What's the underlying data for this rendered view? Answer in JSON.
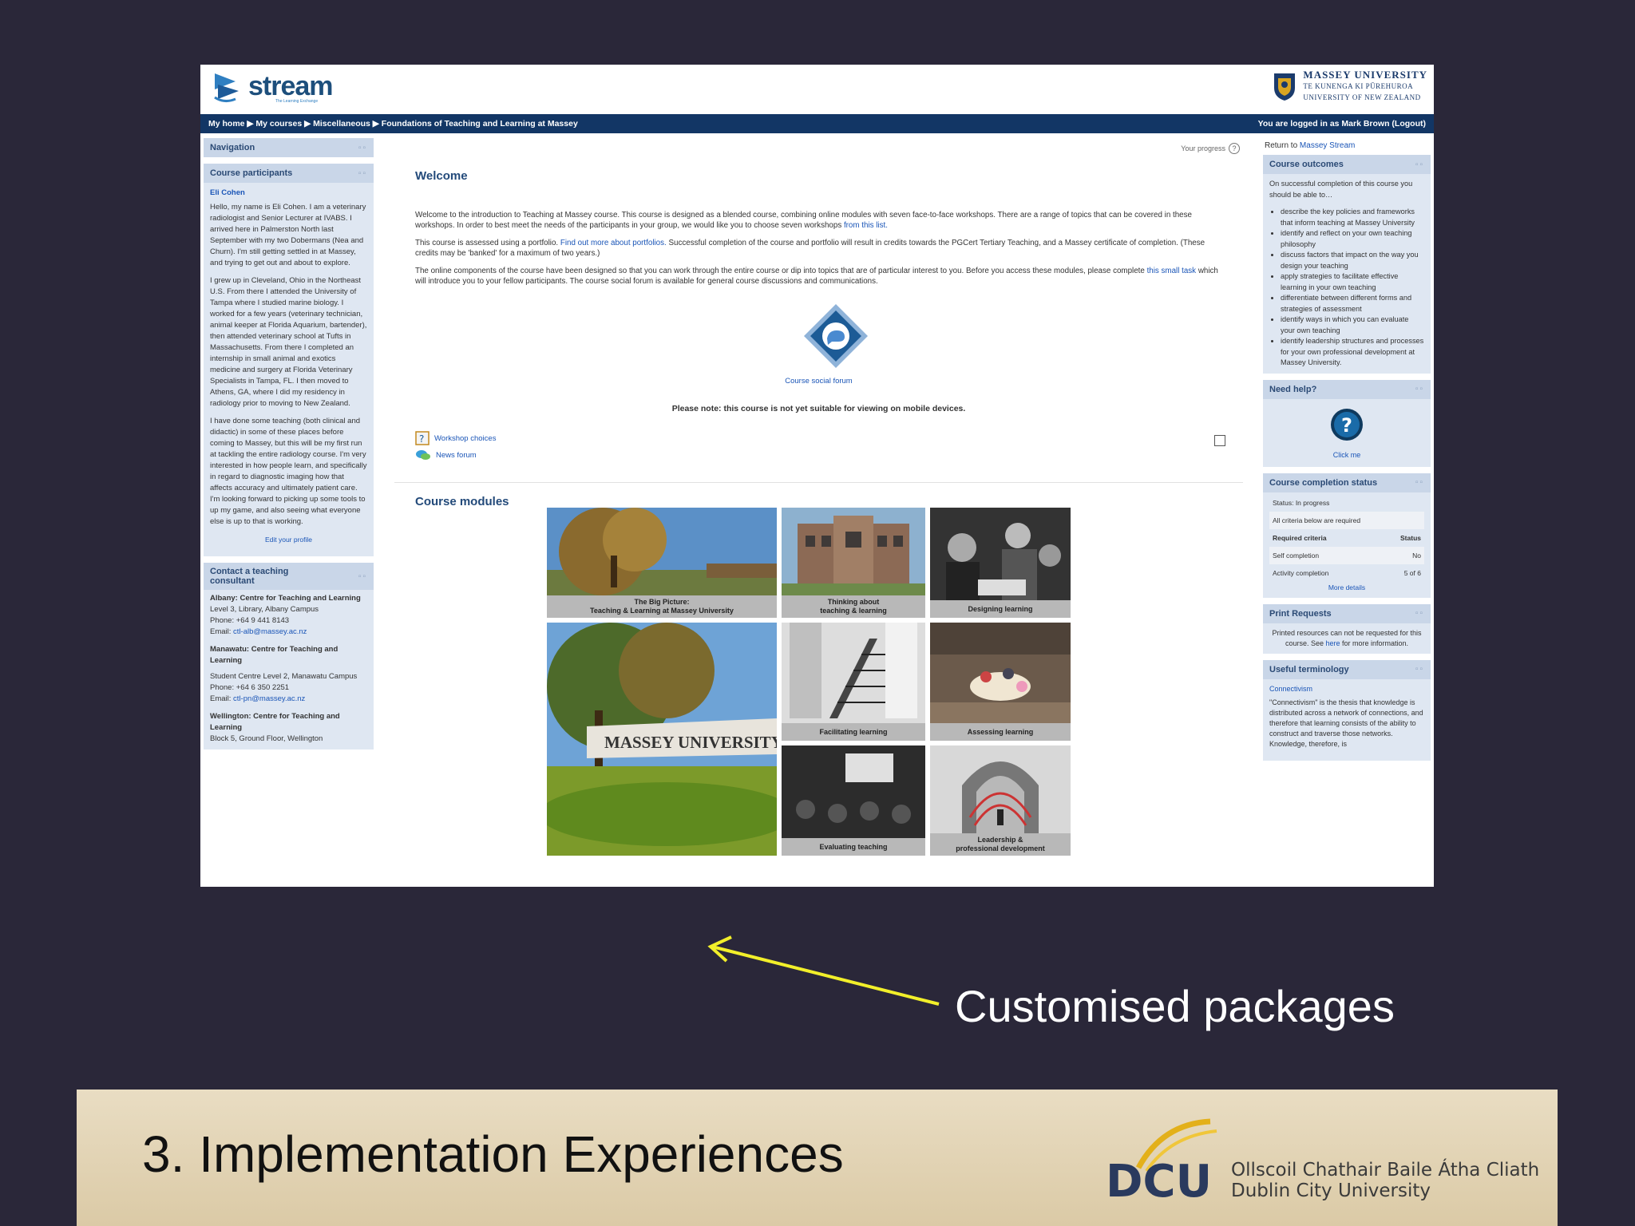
{
  "screenshot": {
    "logo_text": "stream",
    "logo_tagline": "The Learning Exchange",
    "massey_name": "MASSEY UNIVERSITY",
    "massey_maori": "TE KUNENGA KI PŪREHUROA",
    "massey_nz": "UNIVERSITY OF NEW ZEALAND",
    "breadcrumb": "My home ▶ My courses ▶ Miscellaneous ▶ Foundations of Teaching and Learning at Massey",
    "login_text": "You are logged in as Mark Brown (Logout)",
    "left_blocks": {
      "navigation_title": "Navigation",
      "participants_title": "Course participants",
      "participant_name": "Eli Cohen",
      "participant_bio": [
        "Hello, my name is Eli Cohen. I am a veterinary radiologist and Senior Lecturer at IVABS. I arrived here in Palmerston North last September with my two Dobermans (Nea and Churn). I'm still getting settled in at Massey, and trying to get out and about to explore.",
        "I grew up in Cleveland, Ohio in the Northeast U.S. From there I attended the University of Tampa where I studied marine biology. I worked for a few years (veterinary technician, animal keeper at Florida Aquarium, bartender), then attended veterinary school at Tufts in Massachusetts. From there I completed an internship in small animal and exotics medicine and surgery at Florida Veterinary Specialists in Tampa, FL. I then moved to Athens, GA, where I did my residency in radiology prior to moving to New Zealand.",
        "I have done some teaching (both clinical and didactic) in some of these places before coming to Massey, but this will be my first run at tackling the entire radiology course. I'm very interested in how people learn, and specifically in regard to diagnostic imaging how that affects accuracy and ultimately patient care. I'm looking forward to picking up some tools to up my game, and also seeing what everyone else is up to that is working."
      ],
      "edit_profile": "Edit your profile",
      "contact_title": "Contact a teaching consultant",
      "albany_head": "Albany: Centre for Teaching and Learning",
      "albany_body": "Level 3, Library, Albany Campus",
      "albany_phone": "Phone: +64 9 441 8143",
      "albany_email_label": "Email: ",
      "albany_email": "ctl-alb@massey.ac.nz",
      "manawatu_head": "Manawatu: Centre for Teaching and Learning",
      "manawatu_body": "Student Centre Level 2, Manawatu Campus",
      "manawatu_phone": "Phone: +64 6 350 2251",
      "manawatu_email_label": "Email: ",
      "manawatu_email": "ctl-pn@massey.ac.nz",
      "wellington_head": "Wellington: Centre for Teaching and Learning",
      "wellington_body": "Block 5, Ground Floor, Wellington"
    },
    "main": {
      "progress_label": "Your progress",
      "welcome_title": "Welcome",
      "welcome_p1": "Welcome to the introduction to Teaching at Massey course. This course is designed as a blended course, combining online modules with seven face-to-face workshops. There are a range of topics that can be covered in these workshops. In order to best meet the needs of the participants in your group, we would like you to choose seven workshops ",
      "welcome_p1_link": "from this list.",
      "welcome_p2_a": "This course is assessed using a portfolio. ",
      "welcome_p2_link": "Find out more about portfolios.",
      "welcome_p2_b": " Successful completion of the course and portfolio will result in credits towards the PGCert Tertiary Teaching, and a Massey certificate of completion. (These credits may be 'banked' for a maximum of two years.)",
      "welcome_p3_a": "The online components of the course have been designed so that you can work through the entire course or dip into topics that are of particular interest to you. Before you access these modules, please complete ",
      "welcome_p3_link": "this small task",
      "welcome_p3_b": " which will introduce you to your fellow participants. The course social forum is available for general course discussions and communications.",
      "forum_label": "Course social forum",
      "mobile_note": "Please note: this course is not yet suitable for viewing on mobile devices.",
      "activity_1": "Workshop choices",
      "activity_2": "News forum",
      "modules_title": "Course modules",
      "tiles": [
        {
          "caption": "The Big Picture:\nTeaching & Learning at Massey University"
        },
        {
          "caption": "Thinking about\nteaching & learning"
        },
        {
          "caption": "Designing learning"
        },
        {
          "caption": "",
          "sign_text": "MASSEY UNIVERSITY"
        },
        {
          "caption": "Facilitating learning"
        },
        {
          "caption": "Assessing learning"
        },
        {
          "caption": "Evaluating teaching"
        },
        {
          "caption": "Leadership &\nprofessional development"
        }
      ]
    },
    "right_blocks": {
      "return_prefix": "Return to ",
      "return_link": "Massey Stream",
      "outcomes_title": "Course outcomes",
      "outcomes_intro": "On successful completion of this course you should be able to…",
      "outcomes": [
        "describe the key policies and frameworks that inform teaching at Massey University",
        "identify and reflect on your own teaching philosophy",
        "discuss factors that impact on the way you design your teaching",
        "apply strategies to facilitate effective learning in your own teaching",
        "differentiate between different forms and strategies of assessment",
        "identify ways in which you can evaluate your own teaching",
        "identify leadership structures and processes for your own professional development at Massey University."
      ],
      "help_title": "Need help?",
      "help_link": "Click me",
      "completion_title": "Course completion status",
      "status_line": "Status: In progress",
      "criteria_note": "All criteria below are required",
      "col_required": "Required criteria",
      "col_status": "Status",
      "row1_label": "Self completion",
      "row1_value": "No",
      "row2_label": "Activity completion",
      "row2_value": "5 of 6",
      "more_details": "More details",
      "print_title": "Print Requests",
      "print_a": "Printed resources can not be requested for this course. See ",
      "print_link": "here",
      "print_b": " for more information.",
      "terminology_title": "Useful terminology",
      "term_name": "Connectivism",
      "term_def": "\"Connectivism\" is the thesis that knowledge is distributed across a network of connections, and therefore that learning consists of the ability to construct and traverse those networks. Knowledge, therefore, is"
    }
  },
  "annotation": {
    "caption": "Customised packages",
    "arrow_color": "#f2ef2a"
  },
  "footer": {
    "title": "3. Implementation Experiences",
    "dcu_abbr": "DCU",
    "dcu_irish": "Ollscoil Chathair Baile Átha Cliath",
    "dcu_english": "Dublin City University"
  },
  "colors": {
    "background": "#2a2739",
    "navbar": "#123665",
    "block_head": "#c9d6e8",
    "footer": "#e3d4b5"
  }
}
